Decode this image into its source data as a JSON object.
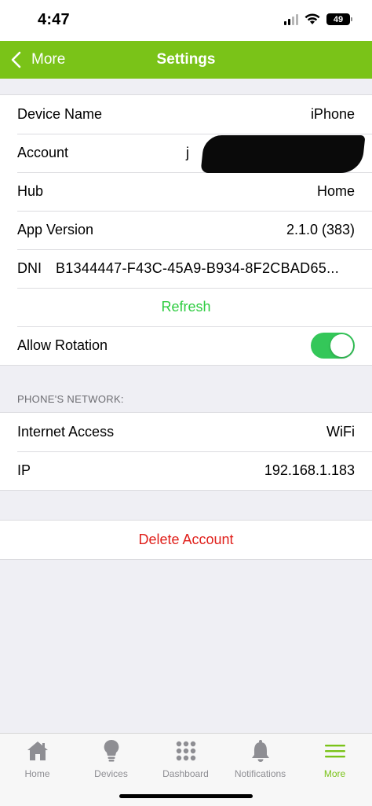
{
  "status_bar": {
    "time": "4:47",
    "battery": "49",
    "icons": [
      "signal-icon",
      "wifi-icon",
      "battery-icon"
    ]
  },
  "navbar": {
    "back_label": "More",
    "title": "Settings",
    "color": "#7ac318"
  },
  "device_section": {
    "rows": [
      {
        "label": "Device Name",
        "value": "iPhone"
      },
      {
        "label": "Account",
        "value": "j"
      },
      {
        "label": "Hub",
        "value": "Home"
      },
      {
        "label": "App Version",
        "value": "2.1.0 (383)"
      },
      {
        "label": "DNI",
        "value": "B1344447-F43C-45A9-B934-8F2CBAD65..."
      }
    ],
    "refresh_label": "Refresh",
    "rotation": {
      "label": "Allow Rotation",
      "enabled": true
    }
  },
  "network_section": {
    "header": "PHONE'S NETWORK:",
    "rows": [
      {
        "label": "Internet Access",
        "value": "WiFi"
      },
      {
        "label": "IP",
        "value": "192.168.1.183"
      }
    ]
  },
  "delete_label": "Delete Account",
  "tabbar": {
    "tabs": [
      {
        "label": "Home",
        "icon": "house-icon"
      },
      {
        "label": "Devices",
        "icon": "lightbulb-icon"
      },
      {
        "label": "Dashboard",
        "icon": "grid-dots-icon"
      },
      {
        "label": "Notifications",
        "icon": "bell-icon"
      },
      {
        "label": "More",
        "icon": "menu-lines-icon",
        "active": true
      }
    ]
  },
  "colors": {
    "accent_green": "#7ac318",
    "refresh_green": "#2ecc40",
    "toggle_green": "#34c759",
    "delete_red": "#e0201b"
  }
}
